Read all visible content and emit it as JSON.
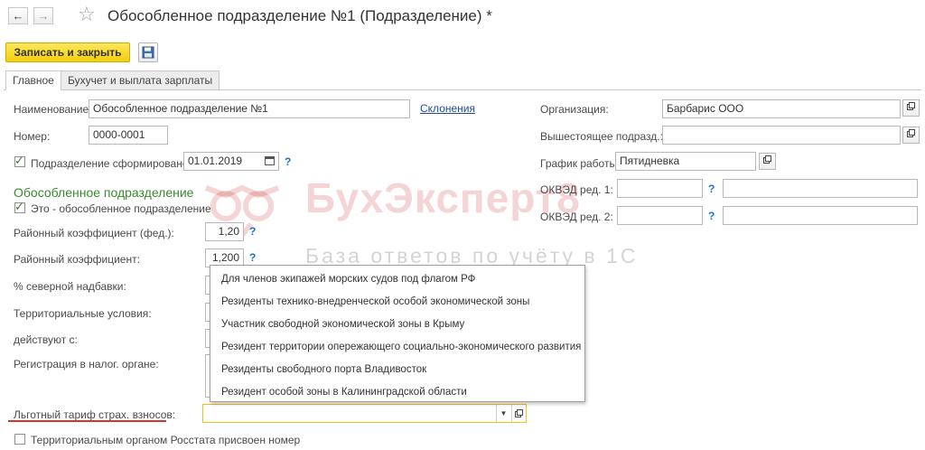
{
  "window": {
    "title": "Обособленное подразделение №1 (Подразделение) *",
    "back_icon": "arrow-left-icon",
    "forward_icon": "arrow-right-icon",
    "favorite_icon": "star-icon"
  },
  "toolbar": {
    "save_close_label": "Записать и закрыть",
    "save_icon": "floppy-disk-icon"
  },
  "tabs": [
    {
      "label": "Главное",
      "active": true
    },
    {
      "label": "Бухучет и выплата зарплаты",
      "active": false
    }
  ],
  "left": {
    "name_label": "Наименование:",
    "name_value": "Обособленное подразделение №1",
    "declension_link": "Склонения",
    "number_label": "Номер:",
    "number_value": "0000-0001",
    "formed_label": "Подразделение сформировано",
    "formed_date": "01.01.2019",
    "formed_checked": true,
    "section_title": "Обособленное подразделение",
    "separate_label": "Это - обособленное подразделение",
    "separate_checked": true,
    "regional_fed_label": "Районный коэффициент (фед.):",
    "regional_fed_value": "1,20",
    "regional_label": "Районный коэффициент:",
    "regional_value": "1,200",
    "northern_label": "% северной надбавки:",
    "territorial_label": "Территориальные условия:",
    "valid_from_label": "действуют с:",
    "tax_reg_label": "Регистрация в налог. органе:",
    "preferential_label": "Льготный тариф страх. взносов:",
    "rosstat_label": "Территориальным органом Росстата присвоен номер",
    "rosstat_checked": false,
    "help_mark": "?"
  },
  "right": {
    "org_label": "Организация:",
    "org_value": "Барбарис ООО",
    "parent_label": "Вышестоящее подразд.:",
    "parent_value": "",
    "schedule_label": "График работы:",
    "schedule_value": "Пятидневка",
    "okved1_label": "ОКВЭД ред. 1:",
    "okved2_label": "ОКВЭД ред. 2:"
  },
  "watermark": {
    "line1": "БухЭксперт8",
    "line2": "База ответов по учёту в 1С"
  },
  "dropdown": {
    "options": [
      "Для членов экипажей морских судов под флагом РФ",
      "Резиденты технико-внедренческой особой экономической зоны",
      "Участник свободной экономической зоны в Крыму",
      "Резидент территории опережающего социально-экономического развития",
      "Резиденты свободного порта Владивосток",
      "Резидент особой зоны в Калининградской области"
    ]
  },
  "colors": {
    "primary_button": "#f3cf10",
    "link": "#1e4ba0",
    "section_title": "#3a8a2f",
    "highlight_underline": "#d9342b"
  }
}
